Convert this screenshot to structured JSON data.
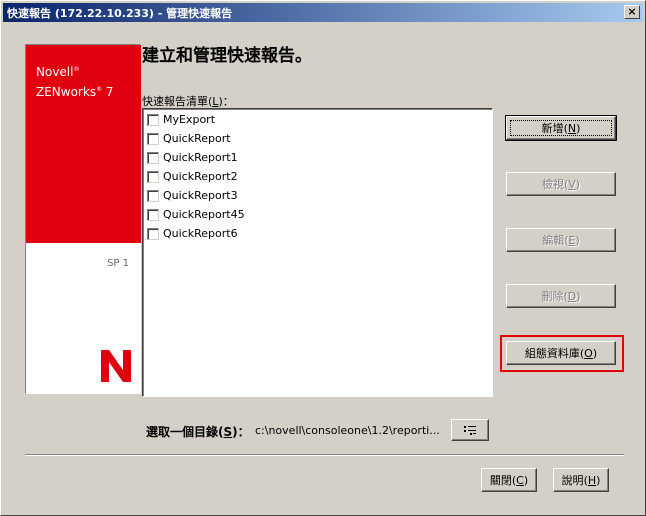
{
  "window": {
    "title": "快速報告 (172.22.10.233) - 管理快速報告",
    "close_glyph": "×"
  },
  "brand": {
    "line1": "Novell",
    "line2": "ZENworks",
    "version": "7",
    "registered": "®",
    "sp": "SP 1",
    "colors": {
      "red": "#e10010"
    }
  },
  "main": {
    "heading": "建立和管理快速報告。",
    "list_label_prefix": "快速報告清單(",
    "list_label_key": "L",
    "list_label_suffix": ")：",
    "reports": [
      "MyExport",
      "QuickReport",
      "QuickReport1",
      "QuickReport2",
      "QuickReport3",
      "QuickReport45",
      "QuickReport6"
    ]
  },
  "buttons": {
    "new": {
      "text": "新增",
      "key": "N"
    },
    "view": {
      "text": "檢視",
      "key": "V"
    },
    "edit": {
      "text": "編輯",
      "key": "E"
    },
    "delete": {
      "text": "刪除",
      "key": "D"
    },
    "config_db": {
      "text": "組態資料庫",
      "key": "O"
    },
    "close": {
      "text": "關閉",
      "key": "C"
    },
    "help": {
      "text": "說明",
      "key": "H"
    }
  },
  "directory": {
    "label_prefix": "選取一個目錄(",
    "label_key": "S",
    "label_suffix": ")：",
    "value": "c:\\novell\\consoleone\\1.2\\reporti...",
    "browse_icon": "browse-icon"
  },
  "colors": {
    "titlebar_start": "#0a246a",
    "titlebar_end": "#a6caf0",
    "highlight": "#e00000"
  }
}
